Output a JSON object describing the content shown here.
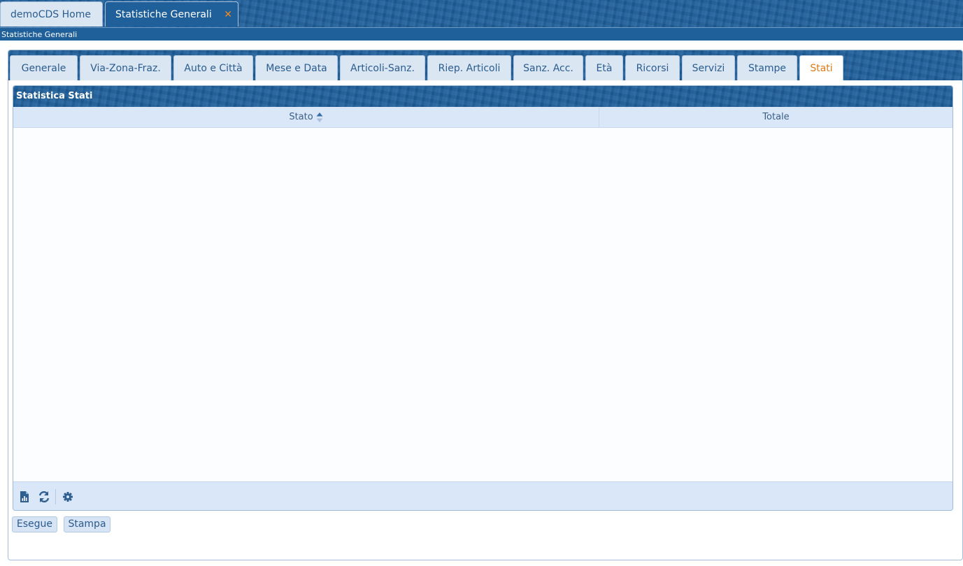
{
  "top_tabs": {
    "home": "demoCDS Home",
    "active": "Statistiche Generali",
    "close_glyph": "✕"
  },
  "breadcrumb": "Statistiche Generali",
  "tabs": [
    {
      "label": "Generale"
    },
    {
      "label": "Via-Zona-Fraz."
    },
    {
      "label": "Auto e Città"
    },
    {
      "label": "Mese e Data"
    },
    {
      "label": "Articoli-Sanz."
    },
    {
      "label": "Riep. Articoli"
    },
    {
      "label": "Sanz. Acc."
    },
    {
      "label": "Età"
    },
    {
      "label": "Ricorsi"
    },
    {
      "label": "Servizi"
    },
    {
      "label": "Stampe"
    },
    {
      "label": "Stati",
      "active": true
    }
  ],
  "panel": {
    "title": "Statistica Stati",
    "columns": [
      "Stato",
      "Totale"
    ],
    "sort_column": "Stato",
    "rows": [],
    "footer_icons": [
      "export-excel-icon",
      "refresh-icon",
      "settings-icon"
    ]
  },
  "buttons": {
    "execute": "Esegue",
    "print": "Stampa"
  },
  "colors": {
    "header_blue": "#1f5f9a",
    "tab_bg": "#dbe6f3",
    "active_tab_text": "#e07a19",
    "close_orange": "#f08a24"
  }
}
